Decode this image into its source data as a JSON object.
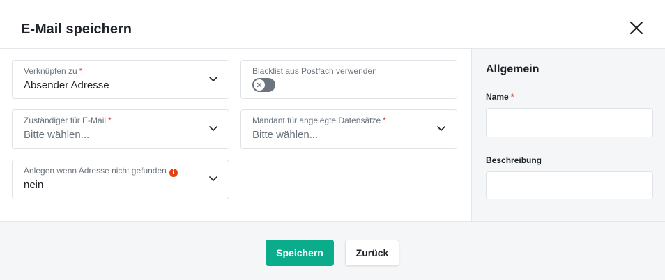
{
  "dialog": {
    "title": "E-Mail speichern",
    "close_icon": "close-icon"
  },
  "form": {
    "link_to": {
      "label": "Verknüpfen zu",
      "required_mark": "*",
      "value": "Absender Adresse"
    },
    "blacklist": {
      "label": "Blacklist aus Postfach verwenden",
      "enabled": false
    },
    "responsible": {
      "label": "Zuständiger für E-Mail",
      "required_mark": "*",
      "placeholder": "Bitte wählen..."
    },
    "tenant": {
      "label": "Mandant für angelegte Datensätze",
      "required_mark": "*",
      "placeholder": "Bitte wählen..."
    },
    "create_if_missing": {
      "label": "Anlegen wenn Adresse nicht gefunden",
      "info_icon": "i",
      "value": "nein"
    }
  },
  "sidebar": {
    "heading": "Allgemein",
    "name_label": "Name",
    "name_required_mark": "*",
    "name_value": "",
    "description_label": "Beschreibung",
    "description_value": ""
  },
  "footer": {
    "save_label": "Speichern",
    "back_label": "Zurück"
  },
  "colors": {
    "primary": "#0aac8b",
    "required": "#e03e2d",
    "info": "#e8410e",
    "toggle_off": "#6c757d"
  }
}
